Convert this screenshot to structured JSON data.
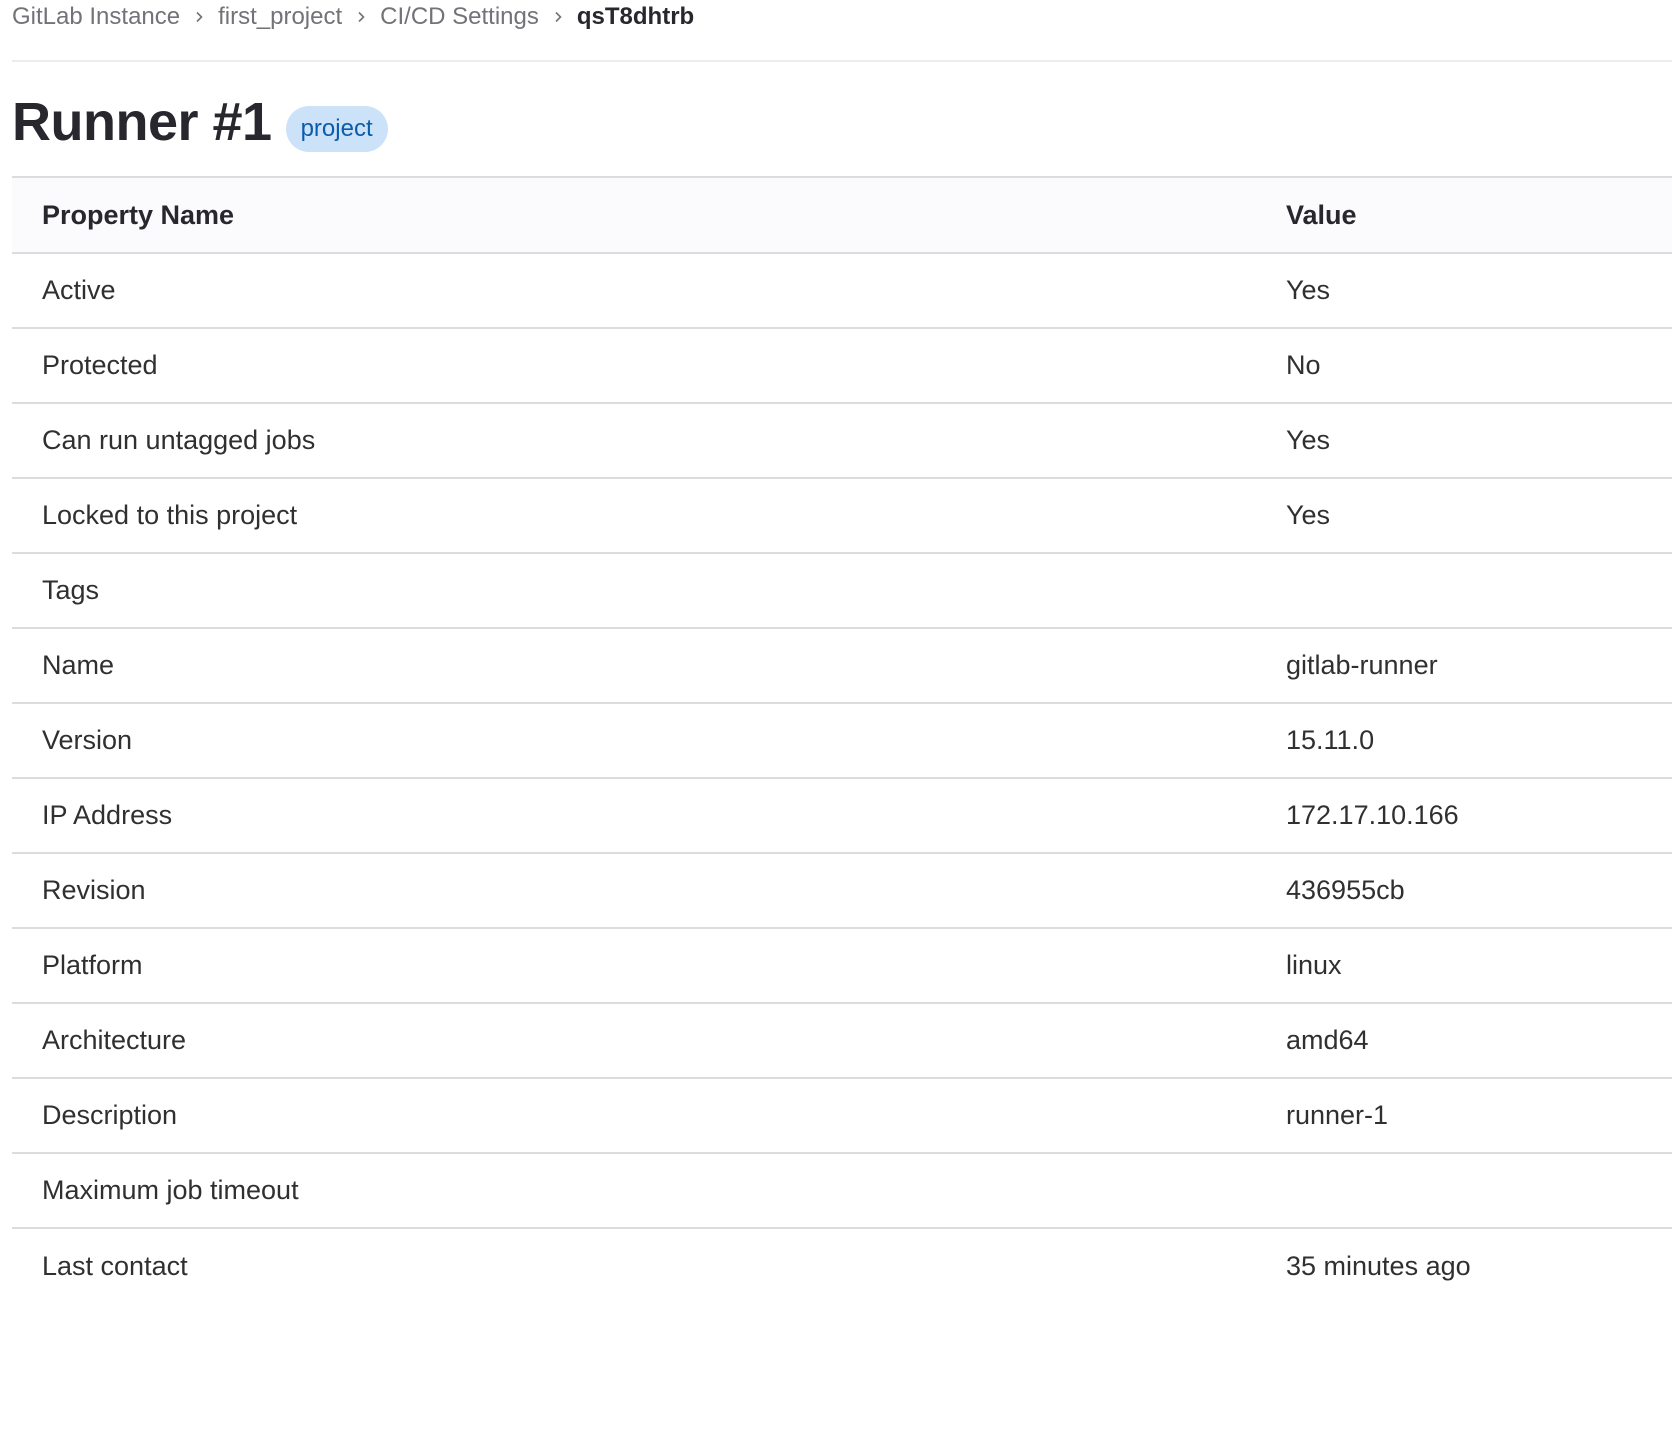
{
  "breadcrumb": {
    "items": [
      {
        "label": "GitLab Instance"
      },
      {
        "label": "first_project"
      },
      {
        "label": "CI/CD Settings"
      }
    ],
    "current": "qsT8dhtrb",
    "separator_icon": "chevron-right-icon"
  },
  "header": {
    "title": "Runner #1",
    "badge": "project"
  },
  "table": {
    "columns": [
      "Property Name",
      "Value"
    ],
    "rows": [
      {
        "name": "Active",
        "value": "Yes"
      },
      {
        "name": "Protected",
        "value": "No"
      },
      {
        "name": "Can run untagged jobs",
        "value": "Yes"
      },
      {
        "name": "Locked to this project",
        "value": "Yes"
      },
      {
        "name": "Tags",
        "value": ""
      },
      {
        "name": "Name",
        "value": "gitlab-runner"
      },
      {
        "name": "Version",
        "value": "15.11.0"
      },
      {
        "name": "IP Address",
        "value": "172.17.10.166"
      },
      {
        "name": "Revision",
        "value": "436955cb"
      },
      {
        "name": "Platform",
        "value": "linux"
      },
      {
        "name": "Architecture",
        "value": "amd64"
      },
      {
        "name": "Description",
        "value": "runner-1"
      },
      {
        "name": "Maximum job timeout",
        "value": ""
      },
      {
        "name": "Last contact",
        "value": "35 minutes ago"
      }
    ]
  },
  "colors": {
    "badge_bg": "#cbe2f9",
    "badge_text": "#0b5cad",
    "border": "#dcdcde",
    "header_bg": "#fbfafd"
  }
}
